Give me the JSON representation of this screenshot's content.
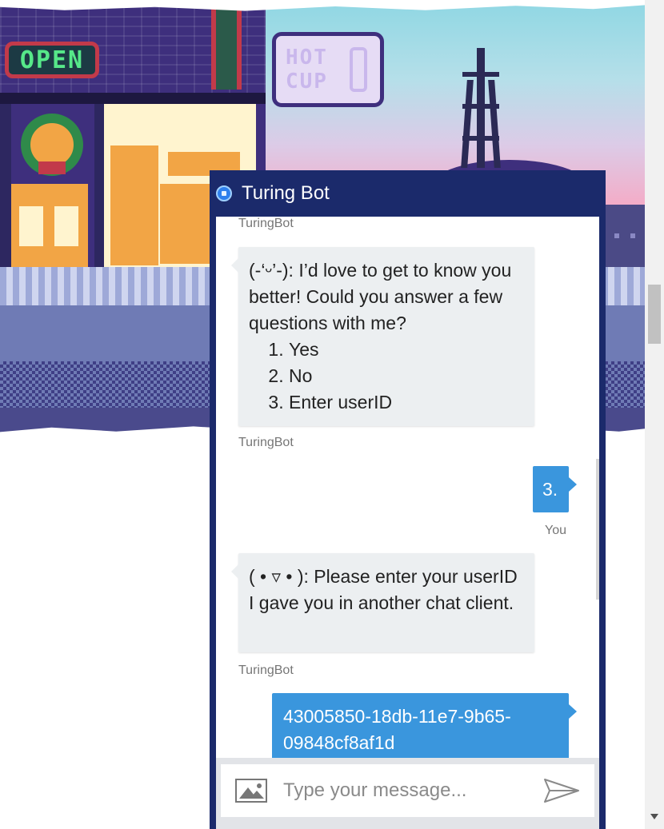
{
  "scene": {
    "open_sign": "OPEN",
    "hot_sign_line1": "HOT",
    "hot_sign_line2": "CUP"
  },
  "chat": {
    "title": "Turing Bot",
    "messages": [
      {
        "sender": "TuringBot"
      },
      {
        "sender": "TuringBot",
        "intro": "(-‘ᵕ’-): I’d love to get to know you better! Could you answer a few questions with me?",
        "options": [
          "Yes",
          "No",
          "Enter userID"
        ]
      },
      {
        "sender": "You",
        "text": "3."
      },
      {
        "sender": "TuringBot",
        "text": "( • ▿ • ): Please enter your userID I gave you in another chat client."
      },
      {
        "text_line1": "43005850-18db-11e7-9b65-",
        "text_line2": "09848cf8af1d"
      }
    ],
    "input": {
      "placeholder": "Type your message..."
    }
  },
  "icons": {
    "bot": "bot-icon",
    "attach": "image-upload-icon",
    "send": "send-arrow-icon"
  },
  "colors": {
    "chat_frame": "#1b2a6b",
    "user_bubble": "#3a96dd",
    "bot_bubble": "#eceff1"
  }
}
